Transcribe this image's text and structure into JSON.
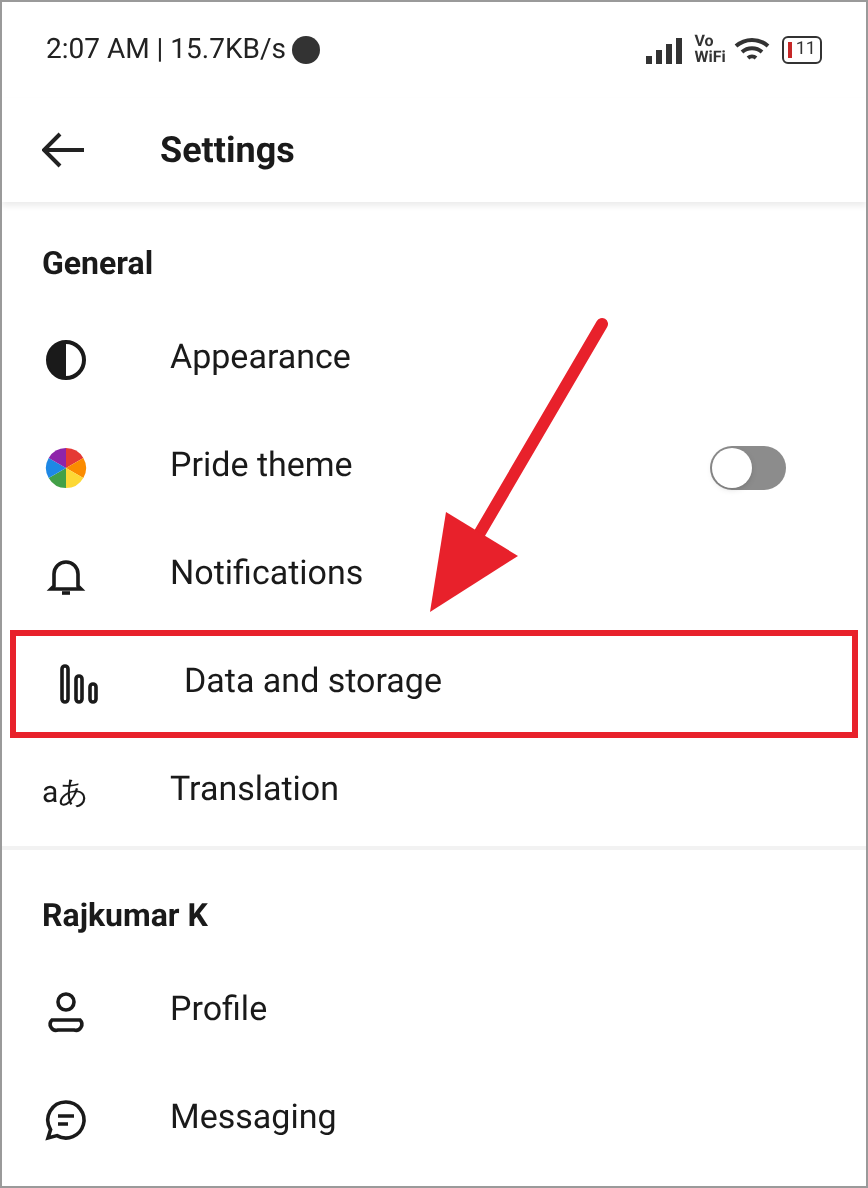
{
  "status_bar": {
    "time": "2:07 AM | 15.7KB/s",
    "vowifi_top": "Vo",
    "vowifi_bottom": "WiFi",
    "battery": "11"
  },
  "header": {
    "title": "Settings"
  },
  "sections": [
    {
      "title": "General",
      "items": [
        {
          "kind": "link",
          "label": "Appearance",
          "highlighted": false
        },
        {
          "kind": "toggle",
          "label": "Pride theme",
          "on": false,
          "highlighted": false
        },
        {
          "kind": "link",
          "label": "Notifications",
          "highlighted": false
        },
        {
          "kind": "link",
          "label": "Data and storage",
          "highlighted": true
        },
        {
          "kind": "link",
          "icon_text": "aあ",
          "label": "Translation",
          "highlighted": false
        }
      ]
    },
    {
      "title": "Rajkumar K",
      "items": [
        {
          "kind": "link",
          "label": "Profile",
          "highlighted": false
        },
        {
          "kind": "link",
          "label": "Messaging",
          "highlighted": false
        }
      ]
    }
  ]
}
